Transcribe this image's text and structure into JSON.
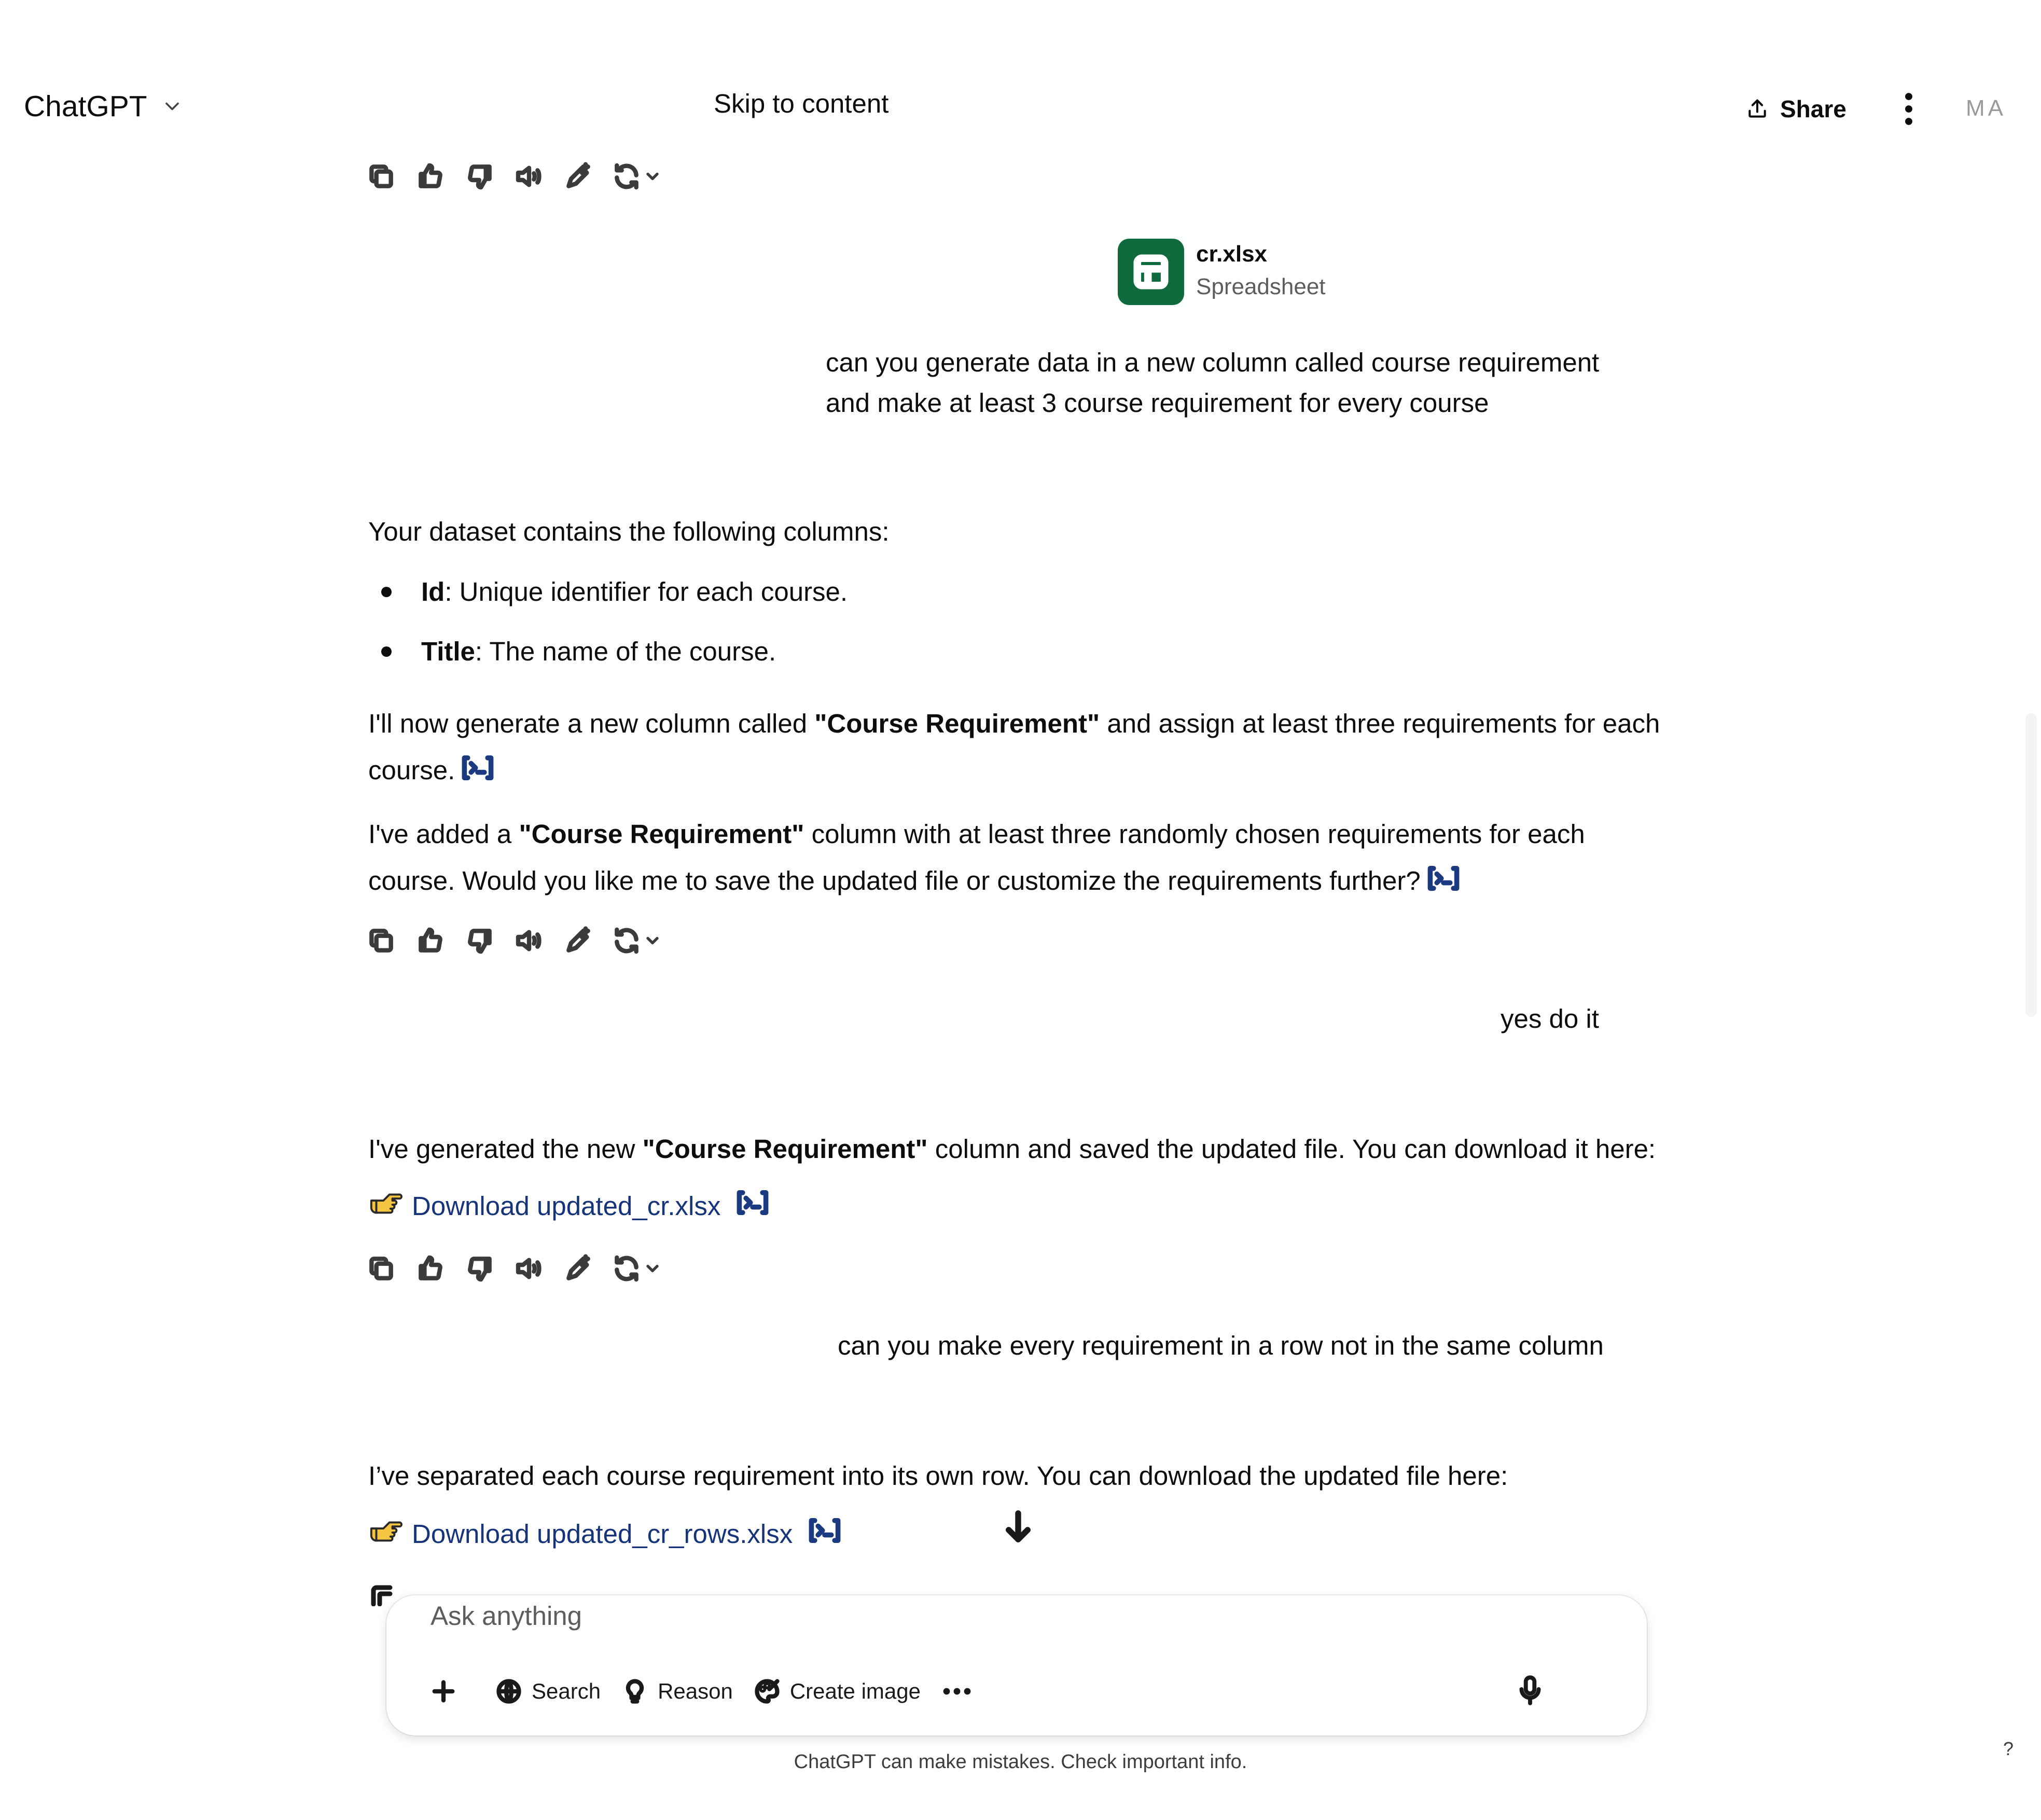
{
  "header": {
    "app_title": "ChatGPT",
    "skip_link": "Skip to content",
    "share_label": "Share",
    "user_initials": "MA"
  },
  "attachment": {
    "file_name": "cr.xlsx",
    "file_type": "Spreadsheet"
  },
  "messages": {
    "user1": {
      "line1": "can you generate data in a new column called course requirement",
      "line2": "and make at least 3 course requirement  for every course"
    },
    "assistant1": {
      "intro": "Your dataset contains the following columns:",
      "bullets": [
        {
          "term": "Id",
          "desc": ": Unique identifier for each course."
        },
        {
          "term": "Title",
          "desc": ": The name of the course."
        }
      ],
      "p1_pre": "I'll now generate a new column called ",
      "p1_bold": "\"Course Requirement\"",
      "p1_post": " and assign at least three requirements for each",
      "p1_line2": "course.",
      "p2_pre": "I've added a ",
      "p2_bold": "\"Course Requirement\"",
      "p2_post": " column with at least three randomly chosen requirements for each",
      "p2_line2": "course. Would you like me to save the updated file or customize the requirements further?"
    },
    "user2": {
      "text": "yes do it"
    },
    "assistant2": {
      "p_pre": "I've generated the new ",
      "p_bold": "\"Course Requirement\"",
      "p_post": " column and saved the updated file. You can download it here:",
      "link": "Download updated_cr.xlsx"
    },
    "user3": {
      "text": "can you make every requirement in a row not in the same column"
    },
    "assistant3": {
      "text": "I’ve separated each course requirement into its own row. You can download the updated file here:",
      "link": "Download updated_cr_rows.xlsx"
    }
  },
  "composer": {
    "placeholder": "Ask anything",
    "tools": {
      "search": "Search",
      "reason": "Reason",
      "create_image": "Create image"
    }
  },
  "footer": {
    "disclaimer": "ChatGPT can make mistakes. Check important info.",
    "help": "?"
  },
  "icons": {
    "message_actions": [
      "copy-icon",
      "thumbs-up-icon",
      "thumbs-down-icon",
      "read-aloud-icon",
      "edit-in-canvas-icon",
      "regenerate-icon"
    ],
    "file": "spreadsheet-icon",
    "link_prefix": "pointing-hand-emoji",
    "citation": "code-citation-icon"
  },
  "colors": {
    "file_icon_bg": "#0f6b3e",
    "link": "#17347a",
    "accent_hand": "#f5c542"
  }
}
